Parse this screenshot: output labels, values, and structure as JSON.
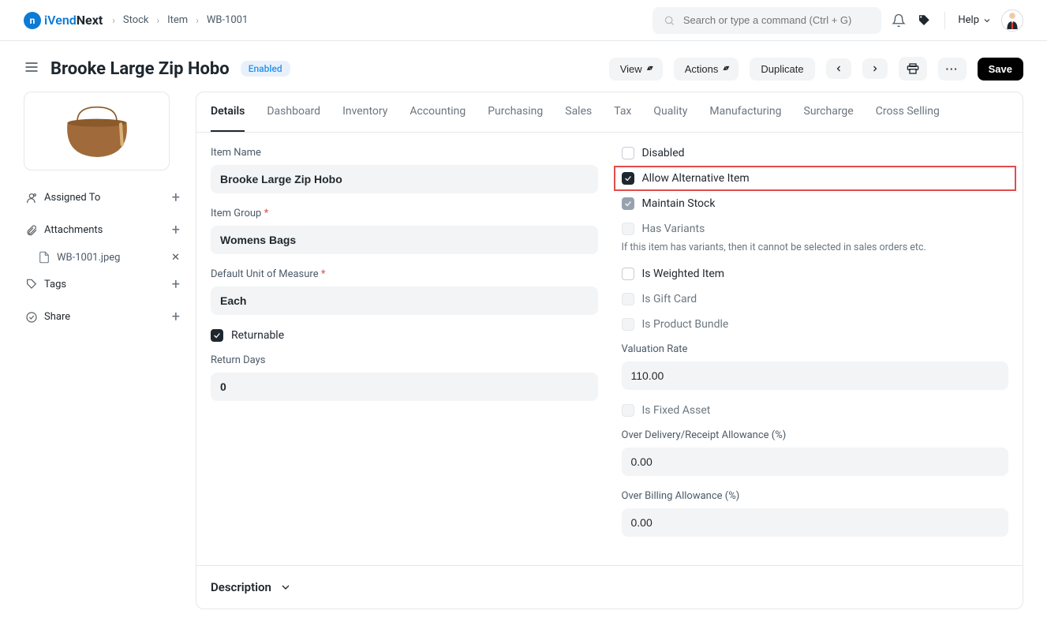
{
  "brand": {
    "part1": "iVend",
    "part2": "Next"
  },
  "breadcrumb": [
    "Stock",
    "Item",
    "WB-1001"
  ],
  "search_placeholder": "Search or type a command (Ctrl + G)",
  "help_label": "Help",
  "page_title": "Brooke Large Zip Hobo",
  "status": "Enabled",
  "header_buttons": {
    "view": "View",
    "actions": "Actions",
    "duplicate": "Duplicate",
    "save": "Save"
  },
  "sidebar": {
    "assigned_to": "Assigned To",
    "attachments": "Attachments",
    "attachment_file": "WB-1001.jpeg",
    "tags": "Tags",
    "share": "Share"
  },
  "tabs": [
    "Details",
    "Dashboard",
    "Inventory",
    "Accounting",
    "Purchasing",
    "Sales",
    "Tax",
    "Quality",
    "Manufacturing",
    "Surcharge",
    "Cross Selling"
  ],
  "active_tab": "Details",
  "left_fields": {
    "item_name": {
      "label": "Item Name",
      "value": "Brooke Large Zip Hobo"
    },
    "item_group": {
      "label": "Item Group",
      "value": "Womens Bags",
      "required": true
    },
    "uom": {
      "label": "Default Unit of Measure",
      "value": "Each",
      "required": true
    },
    "returnable": {
      "label": "Returnable",
      "checked": true
    },
    "return_days": {
      "label": "Return Days",
      "value": "0"
    }
  },
  "right_fields": {
    "disabled": {
      "label": "Disabled",
      "checked": false
    },
    "allow_alt": {
      "label": "Allow Alternative Item",
      "checked": true
    },
    "maintain_stock": {
      "label": "Maintain Stock",
      "checked": true
    },
    "has_variants": {
      "label": "Has Variants",
      "checked": false,
      "help": "If this item has variants, then it cannot be selected in sales orders etc."
    },
    "is_weighted": {
      "label": "Is Weighted Item",
      "checked": false
    },
    "is_gift_card": {
      "label": "Is Gift Card",
      "checked": false
    },
    "is_bundle": {
      "label": "Is Product Bundle",
      "checked": false
    },
    "valuation_rate": {
      "label": "Valuation Rate",
      "value": "110.00"
    },
    "is_fixed_asset": {
      "label": "Is Fixed Asset",
      "checked": false
    },
    "over_delivery": {
      "label": "Over Delivery/Receipt Allowance (%)",
      "value": "0.00"
    },
    "over_billing": {
      "label": "Over Billing Allowance (%)",
      "value": "0.00"
    }
  },
  "description_section": "Description"
}
